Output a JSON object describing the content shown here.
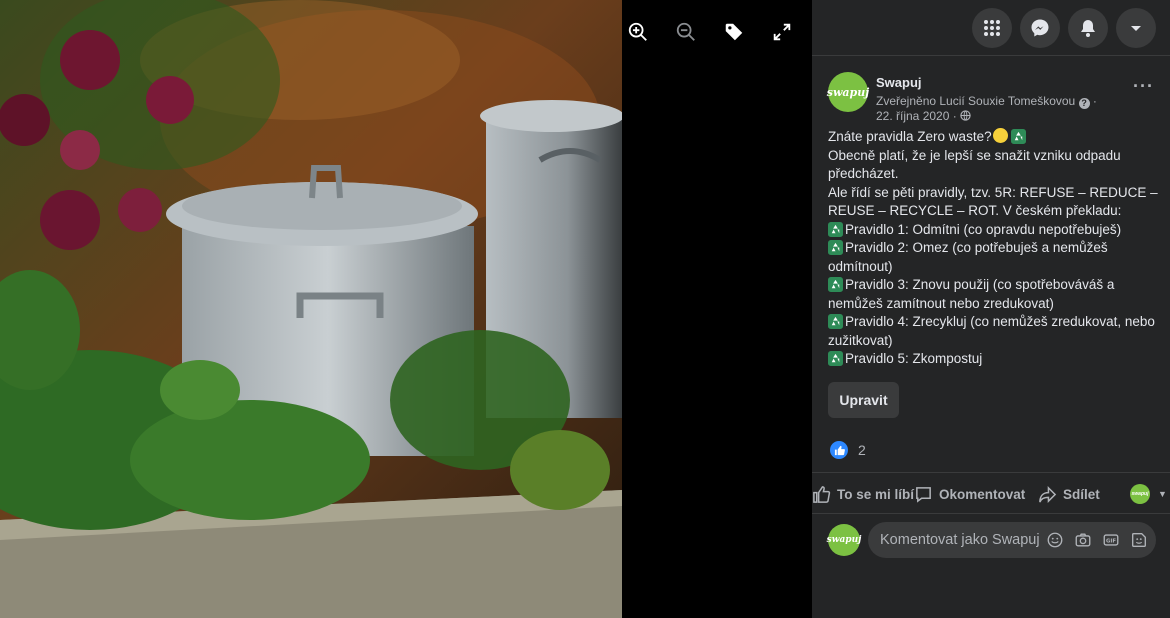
{
  "viewer": {
    "tools": [
      {
        "name": "zoom-in-icon"
      },
      {
        "name": "zoom-out-icon"
      },
      {
        "name": "tag-icon"
      },
      {
        "name": "fullscreen-icon"
      }
    ]
  },
  "topbar": {
    "buttons": [
      "grid-menu-icon",
      "messenger-icon",
      "notifications-bell-icon",
      "account-caret-icon"
    ]
  },
  "post": {
    "avatar_text": "swapuj",
    "page_name": "Swapuj",
    "author_line": "Zveřejněno Lucií Souxie Tomeškovou",
    "date": "22. října 2020",
    "lines": {
      "l1": "Znáte pravidla Zero waste?",
      "l2": "Obecně platí, že je lepší se snažit vzniku odpadu předcházet.",
      "l3": "Ale řídí se pěti pravidly, tzv. 5R: REFUSE – REDUCE – REUSE – RECYCLE – ROT. V českém překladu:",
      "r1": "Pravidlo 1: Odmítni (co opravdu nepotřebuješ)",
      "r2": "Pravidlo 2: Omez (co potřebuješ a nemůžeš odmítnout)",
      "r3": "Pravidlo 3: Znovu použij (co spotřebováváš a nemůžeš zamítnout nebo zredukovat)",
      "r4": "Pravidlo 4: Zrecykluj (co nemůžeš zredukovat, nebo zužitkovat)",
      "r5": "Pravidlo 5: Zkompostuj"
    },
    "edit_label": "Upravit",
    "reaction_count": "2"
  },
  "actions": {
    "like": "To se mi líbí",
    "comment": "Okomentovat",
    "share": "Sdílet"
  },
  "comment": {
    "placeholder": "Komentovat jako Swapuj"
  },
  "colors": {
    "panel_bg": "#242526",
    "button_bg": "#3a3b3c",
    "text_primary": "#e4e6eb",
    "text_secondary": "#b0b3b8",
    "brand_green": "#7cc142",
    "like_blue": "#2d88ff"
  }
}
